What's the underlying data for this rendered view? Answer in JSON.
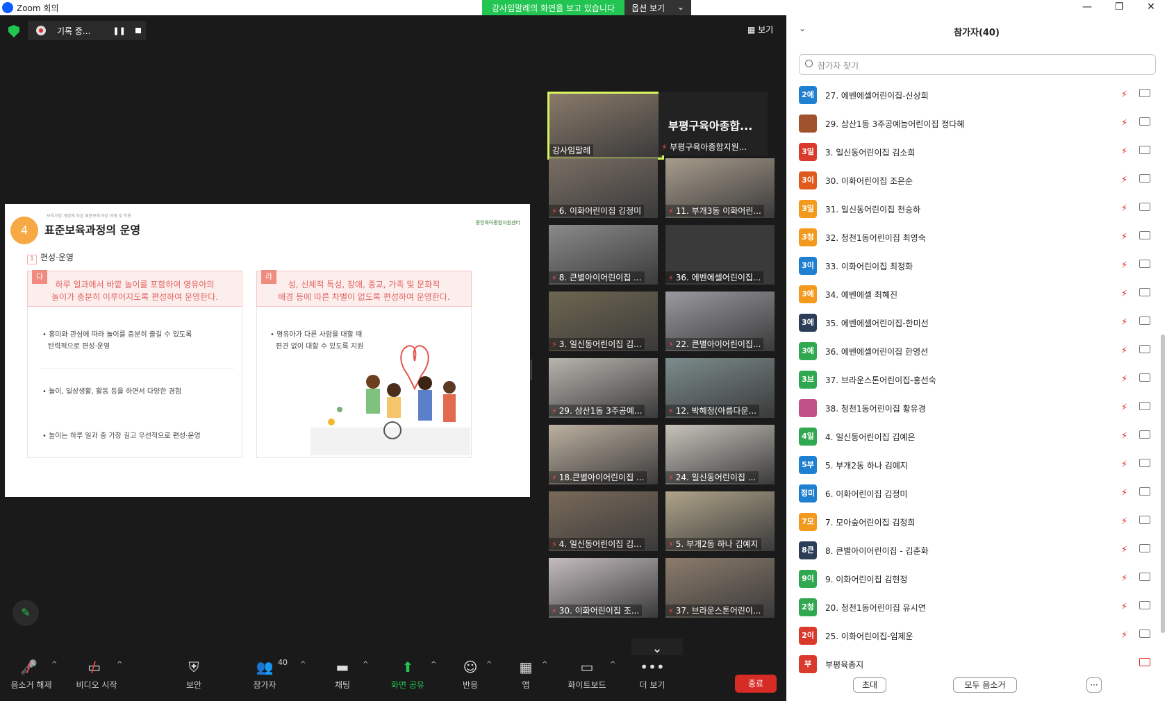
{
  "window": {
    "title": "Zoom 회의",
    "share_banner": "강사임말례의 화면을 보고 있습니다",
    "options_label": "옵션 보기",
    "controls": [
      "—",
      "❐",
      "✕"
    ]
  },
  "meeting": {
    "recording_label": "기록 중...",
    "view_label": "보기"
  },
  "slide": {
    "number": "4",
    "small_header": "보육과정 개정에 따른 표준보육과정 이해 및 적용",
    "heading": "표준보육과정의 운영",
    "org": "중앙육아종합지원센터",
    "sub_num": "1",
    "sub_title": "편성·운영",
    "left_tag": "다",
    "left_banner": [
      "하루 일과에서 바깥 놀이를 포함하여 영유아의",
      "놀이가 충분히 이루어지도록 편성하여 운영한다."
    ],
    "left_bullets": [
      [
        "흥미와 관심에 따라 놀이를 충분히 즐길 수 있도록",
        "탄력적으로 편성·운영"
      ],
      [
        "놀이, 일상생활, 활동 등을 하면서 다양한 경험"
      ],
      [
        "놀이는 하루 일과 중 가장 길고 우선적으로 편성·운영"
      ]
    ],
    "right_tag": "라",
    "right_banner": [
      "성, 신체적 특성, 장애, 종교, 가족 및 문화적",
      "배경 등에 따른 차별이 없도록 편성하여 운영한다."
    ],
    "right_bullets": [
      [
        "영유아가 다른 사람을 대할 때",
        "편견 없이 대할 수 있도록 지원"
      ]
    ]
  },
  "tiles": [
    {
      "name": "강사임말례",
      "muted": false,
      "color": "#8a7a6a"
    },
    {
      "name": "부평구육아종합...",
      "muted": true,
      "color": "#222",
      "label": "부평구육아종합지원..."
    },
    {
      "name": "6. 이화어린이집 김정미",
      "muted": true,
      "color": "#7a6e64"
    },
    {
      "name": "11. 부개3동 이화어린...",
      "muted": true,
      "color": "#a89c8c"
    },
    {
      "name": "8. 큰별아이어린이집 ...",
      "muted": true,
      "color": "#8a8a8a"
    },
    {
      "name": "36. 에벤에셀어린이집...",
      "muted": true,
      "color": "#3a3a3a"
    },
    {
      "name": "3. 일신동어린이집 김...",
      "muted": true,
      "color": "#6e6650"
    },
    {
      "name": "22. 큰별아이어린이집...",
      "muted": true,
      "color": "#9a9aa0"
    },
    {
      "name": "29. 삼산1동 3주공예...",
      "muted": true,
      "color": "#b8b4ae"
    },
    {
      "name": "12. 박혜정(아름다운...",
      "muted": true,
      "color": "#7c8c8c"
    },
    {
      "name": "18.큰별아이어린이집 ...",
      "muted": true,
      "color": "#bdb0a0"
    },
    {
      "name": "24. 일신동어린이집 ...",
      "muted": true,
      "color": "#c8c4bc"
    },
    {
      "name": "4. 일신동어린이집 김...",
      "muted": true,
      "color": "#7a6a5a"
    },
    {
      "name": "5. 부개2동 하나 김예지",
      "muted": true,
      "color": "#b0a48a"
    },
    {
      "name": "30. 이화어린이집 조...",
      "muted": true,
      "color": "#c4bcc0"
    },
    {
      "name": "37. 브라운스톤어린이...",
      "muted": true,
      "color": "#8c7c6c"
    }
  ],
  "toolbar": {
    "items": [
      {
        "label": "음소거 해제",
        "icon": "🎤"
      },
      {
        "label": "비디오 시작",
        "icon": "📹"
      },
      {
        "label": "보안",
        "icon": "🛡"
      },
      {
        "label": "참가자",
        "icon": "👥"
      },
      {
        "label": "채팅",
        "icon": "💬"
      },
      {
        "label": "화면 공유",
        "icon": "⬆"
      },
      {
        "label": "반응",
        "icon": "☺"
      },
      {
        "label": "앱",
        "icon": "▦"
      },
      {
        "label": "화이트보드",
        "icon": "▭"
      },
      {
        "label": "더 보기",
        "icon": "•••"
      }
    ],
    "participant_count": "40",
    "end_label": "종료"
  },
  "participants_panel": {
    "title": "참가자(40)",
    "search_placeholder": "참가자 찾기",
    "rows": [
      {
        "avatar": "2에",
        "color": "#1f7fd1",
        "name": "27. 에벤에셀어린이집-신상희",
        "cam_off": false
      },
      {
        "avatar": "",
        "color": "#a0522d",
        "name": "29. 삼산1동 3주공예능어린이집 정다혜",
        "cam_off": false
      },
      {
        "avatar": "3일",
        "color": "#d93a2b",
        "name": "3. 일신동어린이집 김소희",
        "cam_off": false
      },
      {
        "avatar": "3이",
        "color": "#e05a1c",
        "name": "30. 이화어린이집 조은순",
        "cam_off": false
      },
      {
        "avatar": "3일",
        "color": "#f39a1e",
        "name": "31. 일신동어린이집 천승하",
        "cam_off": false
      },
      {
        "avatar": "3청",
        "color": "#f39a1e",
        "name": "32. 청천1동어린이집 최영숙",
        "cam_off": false
      },
      {
        "avatar": "3이",
        "color": "#1f7fd1",
        "name": "33. 이화어린이집 최정화",
        "cam_off": false
      },
      {
        "avatar": "3에",
        "color": "#f39a1e",
        "name": "34. 에벤에셀 최혜진",
        "cam_off": false
      },
      {
        "avatar": "3에",
        "color": "#2c3e57",
        "name": "35. 에벤에셀어린이집-한미선",
        "cam_off": false
      },
      {
        "avatar": "3에",
        "color": "#2fa84f",
        "name": "36. 에벤에셀어린이집  한영선",
        "cam_off": false
      },
      {
        "avatar": "3브",
        "color": "#2fa84f",
        "name": "37. 브라운스톤어린이집-홍선숙",
        "cam_off": false
      },
      {
        "avatar": "",
        "color": "#c05088",
        "name": "38. 청천1동어린이집 황유경",
        "cam_off": false
      },
      {
        "avatar": "4일",
        "color": "#2fa84f",
        "name": "4. 일신동어린이집 김예은",
        "cam_off": false
      },
      {
        "avatar": "5부",
        "color": "#1f7fd1",
        "name": "5. 부개2동 하나 김예지",
        "cam_off": false
      },
      {
        "avatar": "정미",
        "color": "#1f7fd1",
        "name": "6. 이화어린이집 김정미",
        "cam_off": false
      },
      {
        "avatar": "7모",
        "color": "#f39a1e",
        "name": "7. 모아숲어린이집 김정희",
        "cam_off": false
      },
      {
        "avatar": "8큰",
        "color": "#2c3e57",
        "name": "8. 큰별아이어린이집 - 김춘화",
        "cam_off": false
      },
      {
        "avatar": "9이",
        "color": "#2fa84f",
        "name": "9. 이화어린이집 김현정",
        "cam_off": false
      },
      {
        "avatar": "2청",
        "color": "#2fa84f",
        "name": "20. 청천1동어린이집 유시연",
        "cam_off": false
      },
      {
        "avatar": "2이",
        "color": "#d93a2b",
        "name": "25. 이화어린이집-임제운",
        "cam_off": false
      },
      {
        "avatar": "부",
        "color": "#d93a2b",
        "name": "부평육종지",
        "cam_off": true
      }
    ],
    "invite_label": "초대",
    "mute_all_label": "모두 음소거",
    "more_label": "···"
  }
}
